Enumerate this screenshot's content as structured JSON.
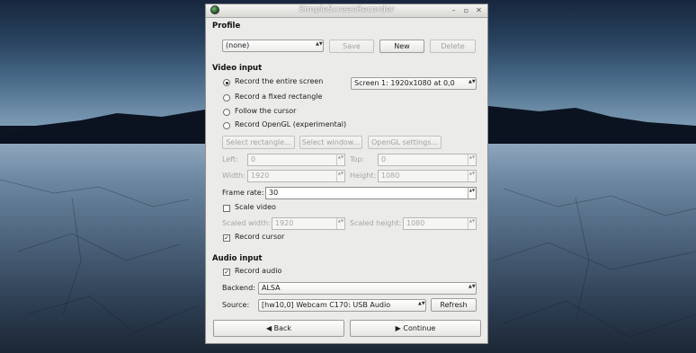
{
  "window": {
    "title": "SimpleScreenRecorder",
    "buttons": [
      "–",
      "▫",
      "✕"
    ]
  },
  "profile": {
    "heading": "Profile",
    "selected": "(none)",
    "save_label": "Save",
    "new_label": "New",
    "delete_label": "Delete"
  },
  "video": {
    "heading": "Video input",
    "options": [
      "Record the entire screen",
      "Record a fixed rectangle",
      "Follow the cursor",
      "Record OpenGL (experimental)"
    ],
    "selected_option": 0,
    "screen_select": "Screen 1: 1920x1080 at 0,0",
    "select_rectangle_label": "Select rectangle...",
    "select_window_label": "Select window...",
    "opengl_settings_label": "OpenGL settings...",
    "left_label": "Left:",
    "left_value": "0",
    "top_label": "Top:",
    "top_value": "0",
    "width_label": "Width:",
    "width_value": "1920",
    "height_label": "Height:",
    "height_value": "1080",
    "frame_rate_label": "Frame rate:",
    "frame_rate_value": "30",
    "scale_video_label": "Scale video",
    "scale_video_checked": false,
    "scaled_width_label": "Scaled width:",
    "scaled_width_value": "1920",
    "scaled_height_label": "Scaled height:",
    "scaled_height_value": "1080",
    "record_cursor_label": "Record cursor",
    "record_cursor_checked": true
  },
  "audio": {
    "heading": "Audio input",
    "record_audio_label": "Record audio",
    "record_audio_checked": true,
    "backend_label": "Backend:",
    "backend_value": "ALSA",
    "source_label": "Source:",
    "source_value": "[hw10,0] Webcam C170: USB Audio",
    "refresh_label": "Refresh"
  },
  "nav": {
    "back_label": "Back",
    "back_icon": "◀",
    "continue_label": "Continue",
    "continue_icon": "▶"
  },
  "icons": {
    "combo_arrow": "▲▼",
    "spin_arrow": "▲▼",
    "check": "✓"
  }
}
